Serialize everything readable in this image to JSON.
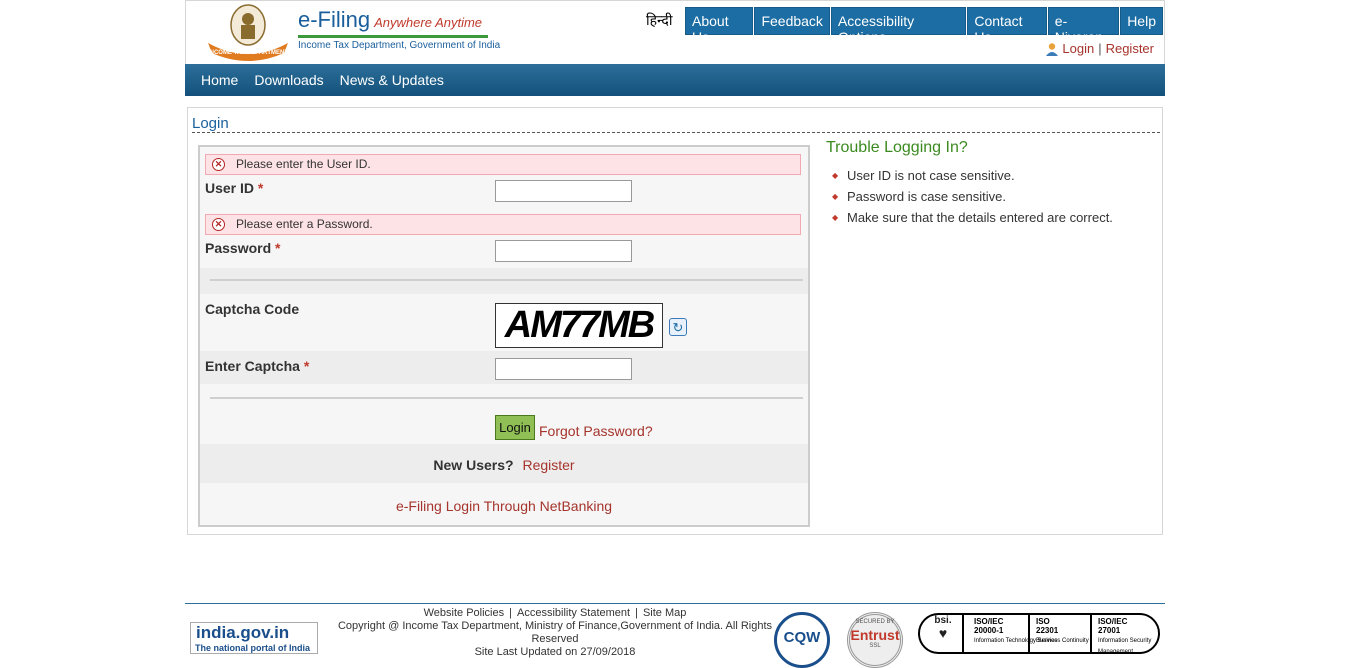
{
  "brand": {
    "name": "e-Filing",
    "tagline": "Anywhere Anytime",
    "dept": "Income Tax Department, Government of India",
    "emblem_text": "INCOME TAX DEPARTMENT"
  },
  "topnav": {
    "hindi": "हिन्दी",
    "items": [
      "About Us",
      "Feedback",
      "Accessibility Options",
      "Contact Us",
      "e-Nivaran",
      "Help"
    ]
  },
  "user_links": {
    "login": "Login",
    "sep": "|",
    "register": "Register"
  },
  "mainnav": {
    "items": [
      "Home",
      "Downloads",
      "News & Updates"
    ]
  },
  "login": {
    "title": "Login",
    "error_userid": "Please enter the User ID.",
    "userid_label": "User ID",
    "error_password": "Please enter a Password.",
    "password_label": "Password",
    "required_mark": "*",
    "captcha_label": "Captcha Code",
    "captcha_text": "AM77MB",
    "enter_captcha_label": "Enter Captcha",
    "login_button": "Login",
    "forgot_password": "Forgot Password?",
    "new_users": "New Users?",
    "register": "Register",
    "netbanking": "e-Filing Login Through NetBanking"
  },
  "trouble": {
    "title": "Trouble Logging In?",
    "items": [
      "User ID is not case sensitive.",
      "Password is case sensitive.",
      "Make sure that the details entered are correct."
    ]
  },
  "footer": {
    "india_title": "india.gov.in",
    "india_sub": "The national portal of India",
    "links": [
      "Website Policies",
      "Accessibility Statement",
      "Site Map"
    ],
    "link_sep": "|",
    "copyright": "Copyright @ Income Tax Department, Ministry of Finance,Government of India. All Rights Reserved",
    "updated": "Site Last Updated on 27/09/2018",
    "stqc": "CQW",
    "entrust": "Entrust",
    "entrust_top": "SECURED BY",
    "entrust_bottom": "SSL",
    "bsi": "bsi.",
    "iso1_title": "ISO/IEC",
    "iso1_num": "20000-1",
    "iso1_desc": "Information Technology Service",
    "iso2_title": "ISO",
    "iso2_num": "22301",
    "iso2_desc": "Business Continuity",
    "iso3_title": "ISO/IEC",
    "iso3_num": "27001",
    "iso3_desc": "Information Security Management"
  },
  "colors": {
    "nav_blue": "#1c6da3",
    "link_red": "#a5342c",
    "green": "#3b8a1f"
  }
}
